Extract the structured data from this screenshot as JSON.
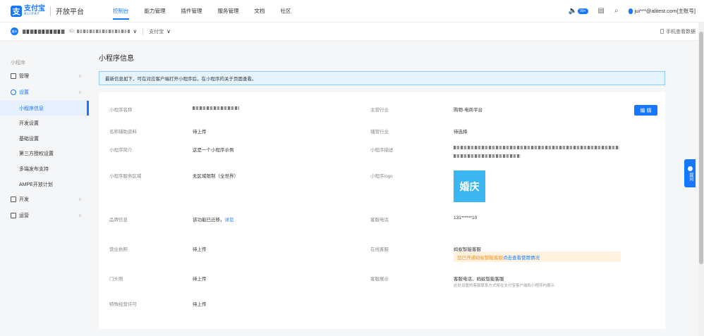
{
  "header": {
    "logo_mark": "支",
    "logo_cn": "支付宝",
    "logo_en": "ALIPAY",
    "platform": "开放平台",
    "nav": [
      {
        "label": "控制台",
        "active": true
      },
      {
        "label": "能力管理"
      },
      {
        "label": "插件管理"
      },
      {
        "label": "服务管理"
      },
      {
        "label": "文档"
      },
      {
        "label": "社区"
      }
    ],
    "badge": "99+",
    "user": "jui***@alitest.com[主账号]"
  },
  "subbar": {
    "avatar_text": "婚庆",
    "id_label": "ID:",
    "type_label": "支付宝",
    "mobile_view": "手机查看数据"
  },
  "sidebar": {
    "heading": "小程序",
    "items": [
      {
        "label": "管理",
        "caret": "∨"
      },
      {
        "label": "设置",
        "caret": "∧"
      },
      {
        "label": "开发",
        "caret": "∨"
      },
      {
        "label": "运营",
        "caret": "∨"
      }
    ],
    "sub_items": [
      "小程序信息",
      "开发设置",
      "基础设置",
      "第三方授权设置",
      "多端发布支持",
      "AMPE开放计划"
    ]
  },
  "main": {
    "title": "小程序信息",
    "notice": "最新信息如下，可在对应客户端打开小程序后，在小程序的关于页面查看。",
    "edit_label": "编 辑",
    "left": [
      {
        "label": "小程序名称",
        "value": ""
      },
      {
        "label": "名称辅助资料",
        "value": "待上传"
      },
      {
        "label": "小程序简介",
        "value": "这是一个小程序示例"
      },
      {
        "label": "小程序服务区域",
        "value": "无区域限制（全世界）"
      },
      {
        "label": "品牌信息",
        "value": "该功能已迁移，",
        "link": "详见"
      },
      {
        "label": "营业执照",
        "value": "待上传"
      },
      {
        "label": "门头照",
        "value": "待上传"
      },
      {
        "label": "特殊经营许可",
        "value": "待上传"
      }
    ],
    "right": [
      {
        "label": "主营行业",
        "value": "购物-电商平台"
      },
      {
        "label": "辅营行业",
        "value": "待选择"
      },
      {
        "label": "小程序描述",
        "value": ""
      },
      {
        "label": "小程序logo",
        "value": ""
      },
      {
        "label": "客服电话",
        "value": "131******10"
      },
      {
        "label": "在线客服",
        "value": "蚂蚁智能客服"
      },
      {
        "label": "客服展示",
        "value": "客服电话、蚂蚁智能客服"
      }
    ],
    "logo_text": "婚庆",
    "warn_text": "您已开通蚂蚁智能客服",
    "warn_link": "点击查看使用情况",
    "display_note": "此处设置的客服联系方式将在支付宝客户端和小程序内展示"
  },
  "feedback": "提问"
}
